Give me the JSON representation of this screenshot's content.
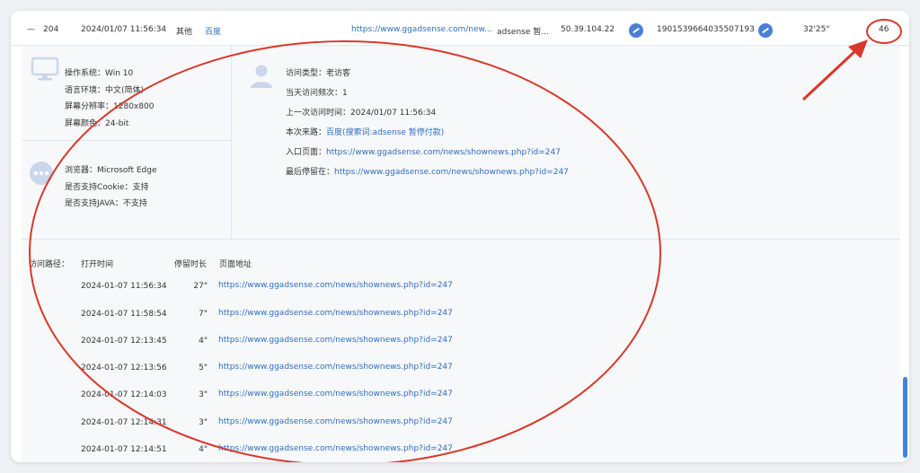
{
  "summary_row": {
    "collapse_symbol": "—",
    "id": "204",
    "datetime": "2024/01/07 11:56:34",
    "type": "其他",
    "source": "百度",
    "url": "https://www.ggadsense.com/new...",
    "keyword": "adsense 暂...",
    "ip": "50.39.104.22",
    "visitor_id": "1901539664035507193",
    "duration": "32'25\"",
    "page_count": "46"
  },
  "system_info": [
    {
      "label": "操作系统：",
      "value": "Win 10"
    },
    {
      "label": "语言环境：",
      "value": "中文(简体)"
    },
    {
      "label": "屏幕分辨率：",
      "value": "1280x800"
    },
    {
      "label": "屏幕颜色：",
      "value": "24-bit"
    }
  ],
  "browser_info": [
    {
      "label": "浏览器：",
      "value": "Microsoft Edge"
    },
    {
      "label": "是否支持Cookie：",
      "value": "支持"
    },
    {
      "label": "是否支持JAVA：",
      "value": "不支持"
    }
  ],
  "visit_info": {
    "visit_type_label": "访问类型：",
    "visit_type": "老访客",
    "freq_label": "当天访问频次：",
    "freq": "1",
    "last_visit_label": "上一次访问时间：",
    "last_visit": "2024/01/07 11:56:34",
    "source_label": "本次来路：",
    "source": "百度(搜索词:adsense 暂停付款)",
    "entry_label": "入口页面：",
    "entry": "https://www.ggadsense.com/news/shownews.php?id=247",
    "exit_label": "最后停留在：",
    "exit": "https://www.ggadsense.com/news/shownews.php?id=247"
  },
  "path": {
    "label": "访问路径：",
    "columns": [
      "打开时间",
      "停留时长",
      "页面地址"
    ],
    "rows": [
      {
        "time": "2024-01-07 11:56:34",
        "stay": "27\"",
        "url": "https://www.ggadsense.com/news/shownews.php?id=247"
      },
      {
        "time": "2024-01-07 11:58:54",
        "stay": "7\"",
        "url": "https://www.ggadsense.com/news/shownews.php?id=247"
      },
      {
        "time": "2024-01-07 12:13:45",
        "stay": "4\"",
        "url": "https://www.ggadsense.com/news/shownews.php?id=247"
      },
      {
        "time": "2024-01-07 12:13:56",
        "stay": "5\"",
        "url": "https://www.ggadsense.com/news/shownews.php?id=247"
      },
      {
        "time": "2024-01-07 12:14:03",
        "stay": "3\"",
        "url": "https://www.ggadsense.com/news/shownews.php?id=247"
      },
      {
        "time": "2024-01-07 12:14:31",
        "stay": "3\"",
        "url": "https://www.ggadsense.com/news/shownews.php?id=247"
      },
      {
        "time": "2024-01-07 12:14:51",
        "stay": "4\"",
        "url": "https://www.ggadsense.com/news/shownews.php?id=247"
      }
    ]
  },
  "colors": {
    "link": "#2f6fbd",
    "annotation": "#d9382a",
    "icon_gray": "#c9d6ec",
    "scrollbar": "#3c86de"
  },
  "icons": [
    "monitor-icon",
    "more-dots-icon",
    "user-icon",
    "browser-icon"
  ]
}
